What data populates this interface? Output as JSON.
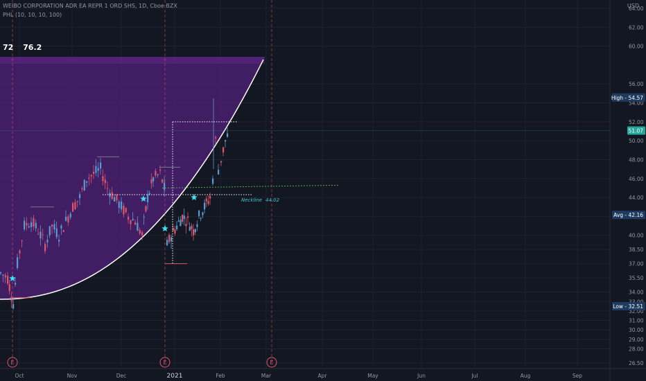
{
  "header": {
    "title": "WEIBO CORPORATION ADR EA REPR 1 ORD SHS, 1D, Cboe BZX",
    "indicator": "PHL (10, 10, 10, 100)",
    "values": [
      "72",
      "76.2"
    ],
    "currency": "USD"
  },
  "colors": {
    "background": "#131722",
    "up": "#5b9bd5",
    "down": "#e0556b",
    "zone": "#4a1f6e",
    "curve": "#ffffff",
    "star": "#3fe0f0",
    "neckline_text": "#3fc9d6"
  },
  "chart_data": {
    "type": "candlestick",
    "x_labels": [
      "Oct",
      "Nov",
      "Dec",
      "2021",
      "Feb",
      "Mar",
      "Apr",
      "May",
      "Jun",
      "Jul",
      "Aug",
      "Sep"
    ],
    "y_ticks": [
      26.5,
      28.0,
      29.0,
      30.0,
      31.0,
      32.0,
      33.0,
      34.0,
      35.5,
      37.0,
      38.5,
      40.0,
      42.0,
      44.0,
      46.0,
      48.0,
      50.0,
      52.0,
      54.0,
      56.0,
      60.0,
      62.0,
      64.0
    ],
    "y_tick_labels": [
      "26.50",
      "28.00",
      "29.00",
      "30.00",
      "31.00",
      "32.00",
      "33.00",
      "34.00",
      "35.50",
      "37.00",
      "38.50",
      "40.00",
      "42.00",
      "44.00",
      "46.00",
      "48.00",
      "50.00",
      "52.00",
      "54.00",
      "56.00",
      "60.00",
      "62.00",
      "64.00"
    ],
    "price_tags": [
      {
        "label": "High",
        "value": 54.57,
        "text": "54.57"
      },
      {
        "label": "",
        "value": 51.07,
        "text": "51.07"
      },
      {
        "label": "Avg",
        "value": 42.16,
        "text": "42.16"
      },
      {
        "label": "Low",
        "value": 32.51,
        "text": "32.51"
      }
    ],
    "neckline": {
      "label": "Neckline",
      "value_text": "44.02"
    },
    "earnings_markers": [
      "E",
      "E",
      "E"
    ]
  }
}
